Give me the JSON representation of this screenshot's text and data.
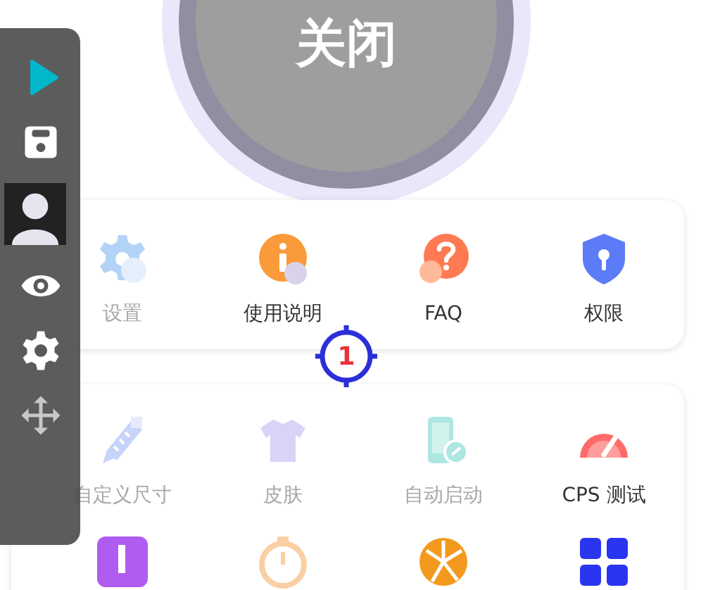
{
  "power_button": {
    "label": "关闭"
  },
  "floating_toolbar": [
    {
      "kind": "play"
    },
    {
      "kind": "save"
    },
    {
      "kind": "avatar"
    },
    {
      "kind": "eye"
    },
    {
      "kind": "settings"
    },
    {
      "kind": "move"
    }
  ],
  "info_card": {
    "items": [
      {
        "label": "设置",
        "disabled": true
      },
      {
        "label": "使用说明",
        "disabled": false
      },
      {
        "label": "FAQ",
        "disabled": false
      },
      {
        "label": "权限",
        "disabled": false
      }
    ]
  },
  "feature_card": {
    "items": [
      {
        "label": "自定义尺寸",
        "disabled": true
      },
      {
        "label": "皮肤",
        "disabled": true
      },
      {
        "label": "自动启动",
        "disabled": true
      },
      {
        "label": "CPS 测试",
        "disabled": false
      },
      {
        "disabled": false
      },
      {
        "disabled": true
      },
      {
        "disabled": false
      },
      {
        "disabled": false
      }
    ]
  },
  "click_point": {
    "label": "1"
  }
}
